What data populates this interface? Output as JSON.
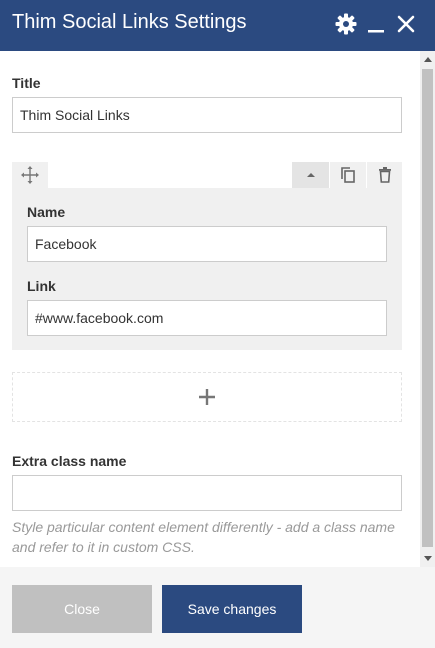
{
  "dialog": {
    "title": "Thim Social Links Settings",
    "icons": [
      "gear-icon",
      "minimize-icon",
      "close-icon"
    ]
  },
  "form": {
    "title_label": "Title",
    "title_value": "Thim Social Links",
    "item": {
      "name_label": "Name",
      "name_value": "Facebook",
      "link_label": "Link",
      "link_value": "#www.facebook.com",
      "toolbar_icons": [
        "move-icon",
        "collapse-icon",
        "duplicate-icon",
        "delete-icon"
      ]
    },
    "add_icon": "plus-icon",
    "extra_class_label": "Extra class name",
    "extra_class_value": "",
    "extra_class_help": "Style particular content element differently - add a class name and refer to it in custom CSS."
  },
  "footer": {
    "close_label": "Close",
    "save_label": "Save changes"
  },
  "colors": {
    "header": "#2b4a80",
    "save_button": "#2b4a80",
    "close_button": "#c0c0c0",
    "group_background": "#f0f0f0"
  }
}
